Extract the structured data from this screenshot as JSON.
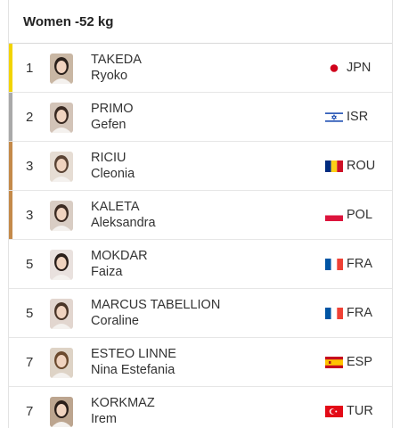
{
  "category": {
    "title": "Women -52 kg"
  },
  "results": [
    {
      "rank": "1",
      "last": "TAKEDA",
      "first": "Ryoko",
      "code": "JPN",
      "flag": "jpn",
      "medal": "#f2d400"
    },
    {
      "rank": "2",
      "last": "PRIMO",
      "first": "Gefen",
      "code": "ISR",
      "flag": "isr",
      "medal": "#a9a9a9"
    },
    {
      "rank": "3",
      "last": "RICIU",
      "first": "Cleonia",
      "code": "ROU",
      "flag": "rou",
      "medal": "#c48a4a"
    },
    {
      "rank": "3",
      "last": "KALETA",
      "first": "Aleksandra",
      "code": "POL",
      "flag": "pol",
      "medal": "#c48a4a"
    },
    {
      "rank": "5",
      "last": "MOKDAR",
      "first": "Faiza",
      "code": "FRA",
      "flag": "fra",
      "medal": ""
    },
    {
      "rank": "5",
      "last": "MARCUS TABELLION",
      "first": "Coraline",
      "code": "FRA",
      "flag": "fra",
      "medal": ""
    },
    {
      "rank": "7",
      "last": "ESTEO LINNE",
      "first": "Nina Estefania",
      "code": "ESP",
      "flag": "esp",
      "medal": ""
    },
    {
      "rank": "7",
      "last": "KORKMAZ",
      "first": "Irem",
      "code": "TUR",
      "flag": "tur",
      "medal": ""
    }
  ]
}
